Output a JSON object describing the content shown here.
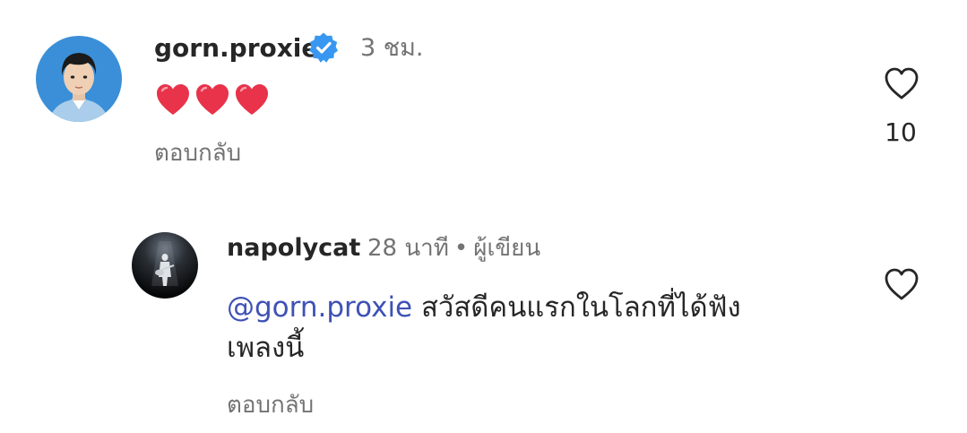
{
  "comments": [
    {
      "username": "gorn.proxie",
      "verified": true,
      "time": "3 ชม.",
      "text": "",
      "emoji": [
        "red-heart",
        "red-heart",
        "red-heart"
      ],
      "reply_label": "ตอบกลับ",
      "like_icon": "heart-outline-icon",
      "like_count": "10"
    },
    {
      "username": "napolycat",
      "time": "28 นาที",
      "separator": "•",
      "badge": "ผู้เขียน",
      "mention": "@gorn.proxie",
      "text_line1": "สวัสดีคนแรกในโลกที่ได้ฟัง",
      "text_line2": "เพลงนี้",
      "reply_label": "ตอบกลับ",
      "like_icon": "heart-outline-icon"
    }
  ],
  "colors": {
    "text_primary": "#262626",
    "text_secondary": "#737373",
    "mention": "#3f51b5",
    "verified_badge": "#3897f0",
    "emoji_heart": "#e8334a"
  }
}
